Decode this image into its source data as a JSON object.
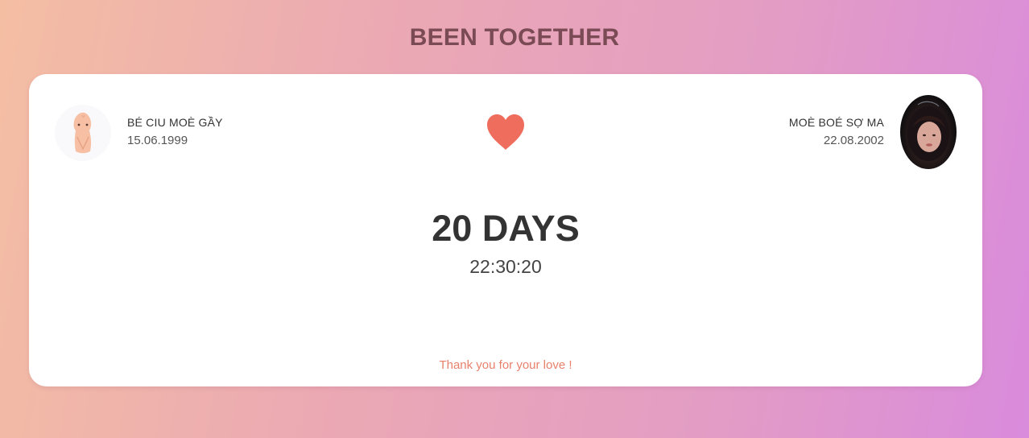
{
  "header": {
    "title": "BEEN TOGETHER"
  },
  "couple": {
    "left": {
      "name": "BÉ CIU MOÈ GẦY",
      "birthdate": "15.06.1999",
      "avatar_icon": "cartoon-character-icon"
    },
    "right": {
      "name": "MOÈ BOÉ SỢ MA",
      "birthdate": "22.08.2002",
      "avatar_icon": "profile-photo"
    },
    "separator_icon": "heart-icon"
  },
  "counter": {
    "days": "20 DAYS",
    "time": "22:30:20"
  },
  "footer": {
    "message": "Thank you for your love !"
  },
  "colors": {
    "heart": "#ee6d5d",
    "title": "#7a4a55",
    "footer_text": "#e8816c",
    "card_background": "#ffffff"
  }
}
